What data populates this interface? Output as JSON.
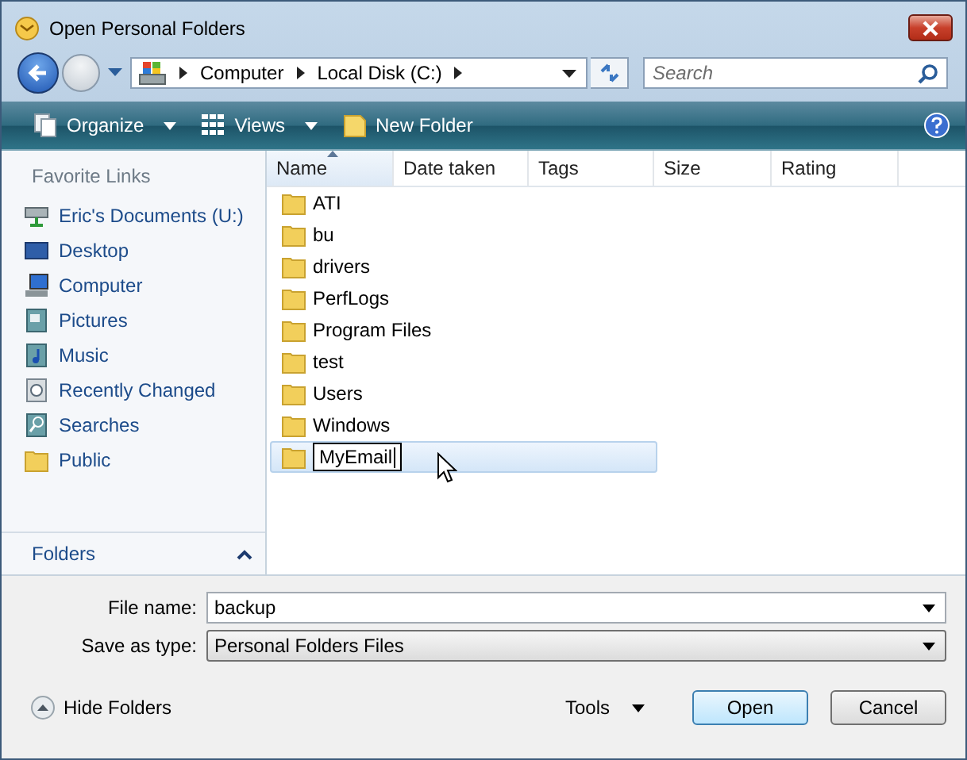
{
  "window": {
    "title": "Open Personal Folders"
  },
  "breadcrumb": [
    "Computer",
    "Local Disk (C:)"
  ],
  "search": {
    "placeholder": "Search"
  },
  "toolbar": [
    {
      "label": "Organize",
      "kind": "menu"
    },
    {
      "label": "Views",
      "kind": "menu"
    },
    {
      "label": "New Folder",
      "kind": "button"
    }
  ],
  "sidebar": {
    "title": "Favorite Links",
    "items": [
      {
        "label": "Eric's Documents (U:)"
      },
      {
        "label": "Desktop"
      },
      {
        "label": "Computer"
      },
      {
        "label": "Pictures"
      },
      {
        "label": "Music"
      },
      {
        "label": "Recently Changed"
      },
      {
        "label": "Searches"
      },
      {
        "label": "Public"
      }
    ],
    "folders_label": "Folders"
  },
  "table": {
    "columns": [
      {
        "label": "Name",
        "sorted": true
      },
      {
        "label": "Date taken",
        "sorted": false
      },
      {
        "label": "Tags",
        "sorted": false
      },
      {
        "label": "Size",
        "sorted": false
      },
      {
        "label": "Rating",
        "sorted": false
      }
    ],
    "rows": [
      {
        "name": "ATI",
        "selected": false,
        "editing": false
      },
      {
        "name": "bu",
        "selected": false,
        "editing": false
      },
      {
        "name": "drivers",
        "selected": false,
        "editing": false
      },
      {
        "name": "PerfLogs",
        "selected": false,
        "editing": false
      },
      {
        "name": "Program Files",
        "selected": false,
        "editing": false
      },
      {
        "name": "test",
        "selected": false,
        "editing": false
      },
      {
        "name": "Users",
        "selected": false,
        "editing": false
      },
      {
        "name": "Windows",
        "selected": false,
        "editing": false
      },
      {
        "name": "MyEmail",
        "selected": true,
        "editing": true
      }
    ]
  },
  "file_name": {
    "label": "File name:",
    "value": "backup"
  },
  "save_as_type": {
    "label": "Save as type:",
    "value": "Personal Folders Files"
  },
  "hide_folders": "Hide Folders",
  "tools": "Tools",
  "buttons": [
    {
      "label": "Open",
      "default": true
    },
    {
      "label": "Cancel",
      "default": false
    }
  ]
}
